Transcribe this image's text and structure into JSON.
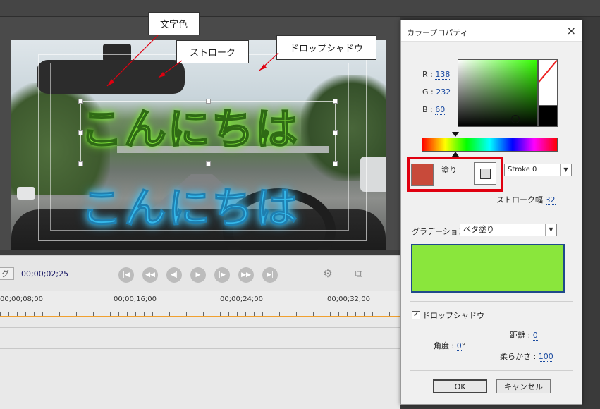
{
  "preview": {
    "title_text_green": "こんにちは",
    "title_text_blue": "こんにちは"
  },
  "callouts": {
    "text_color": "文字色",
    "stroke": "ストローク",
    "drop_shadow": "ドロップシャドウ"
  },
  "transport": {
    "left_tab": "グ",
    "timecode": "00;00;02;25"
  },
  "ruler": {
    "labels": [
      "00;00;08;00",
      "00;00;16;00",
      "00;00;24;00",
      "00;00;32;00"
    ]
  },
  "dialog": {
    "title": "カラープロパティ",
    "close": "×",
    "r_label": "R : ",
    "r_value": "138",
    "g_label": "G : ",
    "g_value": "232",
    "b_label": "B : ",
    "b_value": "60",
    "fill_label": "塗り",
    "stroke_select": "Stroke 0",
    "stroke_width_label": "ストローク幅",
    "stroke_width_value": "32",
    "gradient_label": "グラデーション",
    "gradient_select": "ベタ塗り",
    "drop_shadow_label": "ドロップシャドウ",
    "drop_shadow_checked": "✓",
    "distance_label": "距離 : ",
    "distance_value": "0",
    "angle_label": "角度 : ",
    "angle_value": "0",
    "angle_unit": "°",
    "softness_label": "柔らかさ : ",
    "softness_value": "100",
    "ok": "OK",
    "cancel": "キャンセル"
  },
  "colors": {
    "current_color": "#8ae83c",
    "fill_swatch": "#c84a3a",
    "highlight_box": "#e00010"
  },
  "icons": {
    "transport": [
      "go-to-start-icon",
      "step-back-icon",
      "frame-back-icon",
      "play-icon",
      "frame-forward-icon",
      "step-forward-icon",
      "go-to-end-icon"
    ],
    "monitor": [
      "safe-margin-icon",
      "export-frame-icon"
    ]
  }
}
